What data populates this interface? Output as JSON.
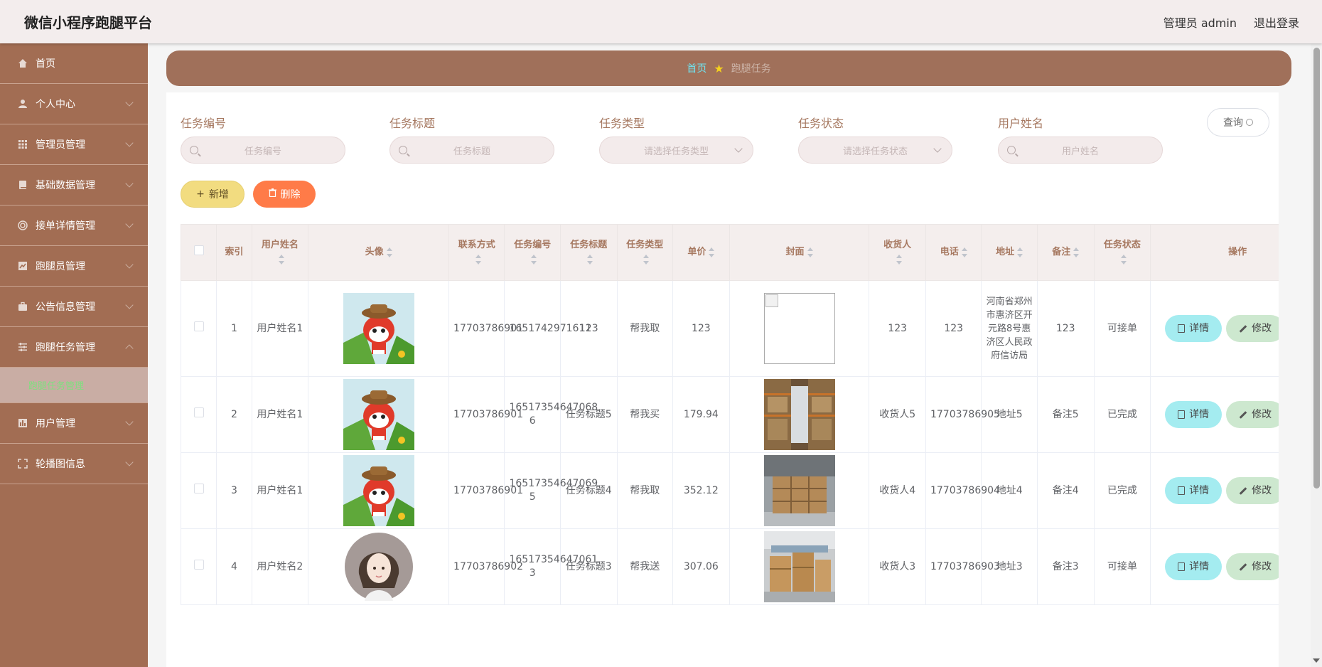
{
  "header": {
    "title": "微信小程序跑腿平台",
    "admin_label": "管理员 admin",
    "logout_label": "退出登录"
  },
  "sidebar": {
    "items": [
      {
        "label": "首页"
      },
      {
        "label": "个人中心"
      },
      {
        "label": "管理员管理"
      },
      {
        "label": "基础数据管理"
      },
      {
        "label": "接单详情管理"
      },
      {
        "label": "跑腿员管理"
      },
      {
        "label": "公告信息管理"
      },
      {
        "label": "跑腿任务管理"
      },
      {
        "label": "用户管理"
      },
      {
        "label": "轮播图信息"
      }
    ],
    "sub_item": "跑腿任务管理"
  },
  "breadcrumb": {
    "home": "首页",
    "current": "跑腿任务"
  },
  "search": {
    "fields": [
      {
        "label": "任务编号",
        "placeholder": "任务编号"
      },
      {
        "label": "任务标题",
        "placeholder": "任务标题"
      },
      {
        "label": "任务类型",
        "placeholder": "请选择任务类型"
      },
      {
        "label": "任务状态",
        "placeholder": "请选择任务状态"
      },
      {
        "label": "用户姓名",
        "placeholder": "用户姓名"
      }
    ],
    "query_label": "查询"
  },
  "actions": {
    "add_label": "新增",
    "delete_label": "删除"
  },
  "table": {
    "headers": [
      "索引",
      "用户姓名",
      "头像",
      "联系方式",
      "任务编号",
      "任务标题",
      "任务类型",
      "单价",
      "封面",
      "收货人",
      "电话",
      "地址",
      "备注",
      "任务状态",
      "操作"
    ],
    "detail_label": "详情",
    "edit_label": "修改",
    "rows": [
      {
        "index": "1",
        "user": "用户姓名1",
        "avatar": "cartoon-avatar",
        "phone": "17703786901",
        "task_no": "1651742971611",
        "title": "123",
        "type": "帮我取",
        "price": "123",
        "cover": "broken-image",
        "receiver": "123",
        "tel": "123",
        "address": "河南省郑州市惠济区开元路8号惠济区人民政府信访局",
        "remark": "123",
        "status": "可接单"
      },
      {
        "index": "2",
        "user": "用户姓名1",
        "avatar": "cartoon-avatar",
        "phone": "17703786901",
        "task_no": "16517354647068 6",
        "title": "任务标题5",
        "type": "帮我买",
        "price": "179.94",
        "cover": "warehouse-aisle",
        "receiver": "收货人5",
        "tel": "17703786905",
        "address": "地址5",
        "remark": "备注5",
        "status": "已完成"
      },
      {
        "index": "3",
        "user": "用户姓名1",
        "avatar": "cartoon-avatar",
        "phone": "17703786901",
        "task_no": "16517354647069 5",
        "title": "任务标题4",
        "type": "帮我取",
        "price": "352.12",
        "cover": "warehouse-boxes",
        "receiver": "收货人4",
        "tel": "17703786904",
        "address": "地址4",
        "remark": "备注4",
        "status": "已完成"
      },
      {
        "index": "4",
        "user": "用户姓名2",
        "avatar": "woman-avatar",
        "phone": "17703786902",
        "task_no": "16517354647061 3",
        "title": "任务标题3",
        "type": "帮我送",
        "price": "307.06",
        "cover": "warehouse-stack",
        "receiver": "收货人3",
        "tel": "17703786903",
        "address": "地址3",
        "remark": "备注3",
        "status": "可接单"
      }
    ]
  },
  "colors": {
    "sidebar": "#a26d53",
    "breadcrumb": "#a0705a",
    "header_text": "#a67860",
    "add": "#f2dc80",
    "delete": "#ff7b48",
    "detail": "#a4ecf0",
    "edit": "#cde8cf"
  }
}
